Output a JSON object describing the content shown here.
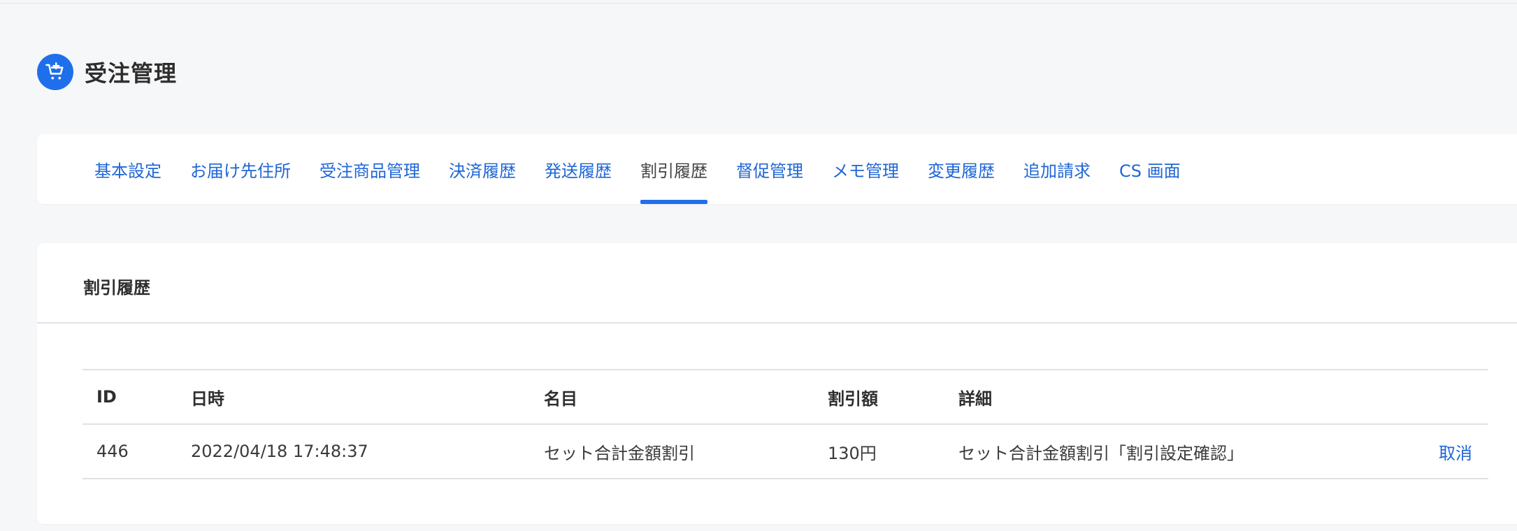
{
  "header": {
    "title": "受注管理",
    "icon": "cart-add-icon",
    "accent_color": "#1f6feb"
  },
  "tabs": [
    {
      "label": "基本設定",
      "active": false
    },
    {
      "label": "お届け先住所",
      "active": false
    },
    {
      "label": "受注商品管理",
      "active": false
    },
    {
      "label": "決済履歴",
      "active": false
    },
    {
      "label": "発送履歴",
      "active": false
    },
    {
      "label": "割引履歴",
      "active": true
    },
    {
      "label": "督促管理",
      "active": false
    },
    {
      "label": "メモ管理",
      "active": false
    },
    {
      "label": "変更履歴",
      "active": false
    },
    {
      "label": "追加請求",
      "active": false
    },
    {
      "label": "CS 画面",
      "active": false
    }
  ],
  "section": {
    "title": "割引履歴"
  },
  "table": {
    "columns": [
      "ID",
      "日時",
      "名目",
      "割引額",
      "詳細"
    ],
    "rows": [
      {
        "id": "446",
        "datetime": "2022/04/18 17:48:37",
        "name": "セット合計金額割引",
        "amount": "130円",
        "detail": "セット合計金額割引「割引設定確認」",
        "action": "取消"
      }
    ]
  }
}
